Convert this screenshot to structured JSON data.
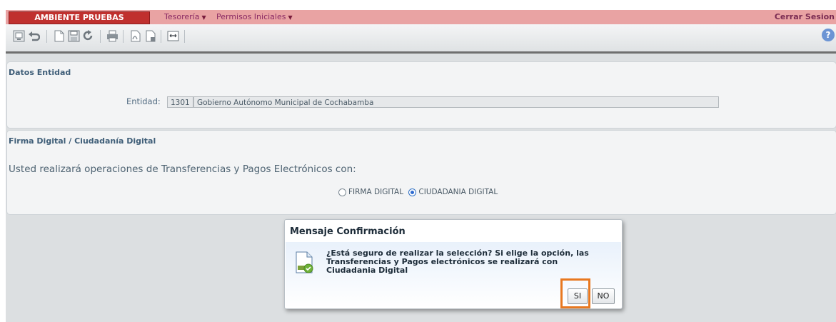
{
  "header": {
    "env_badge": "AMBIENTE PRUEBAS",
    "menus": [
      {
        "label": "Tesorería"
      },
      {
        "label": "Permisos Iniciales"
      }
    ],
    "logout": "Cerrar Sesion"
  },
  "toolbar": {
    "icons": [
      "screen-icon",
      "undo-icon",
      "new-document-icon",
      "save-icon",
      "redo-icon",
      "print-icon",
      "pdf-export-icon",
      "excel-export-icon",
      "fullscreen-icon"
    ],
    "help_label": "?"
  },
  "entity_panel": {
    "title": "Datos Entidad",
    "entity_label": "Entidad:",
    "entity_code": "1301",
    "entity_name": "Gobierno Autónomo Municipal de Cochabamba"
  },
  "signature_panel": {
    "title": "Firma Digital / Ciudadanía Digital",
    "lead": "Usted realizará operaciones de Transferencias y Pagos Electrónicos con:",
    "options": [
      {
        "label": "FIRMA DIGITAL",
        "selected": false
      },
      {
        "label": "CIUDADANIA DIGITAL",
        "selected": true
      }
    ]
  },
  "dialog": {
    "title": "Mensaje Confirmación",
    "message_lines": [
      "¿Está seguro de realizar la selección? Si elige la opción, las",
      "Transferencias y Pagos electrónicos se realizará con",
      "Ciudadania Digital"
    ],
    "yes_label": "SI",
    "no_label": "NO"
  },
  "colors": {
    "topbar": "#e9a3a3",
    "badge": "#c0302e",
    "highlight": "#e87820"
  }
}
